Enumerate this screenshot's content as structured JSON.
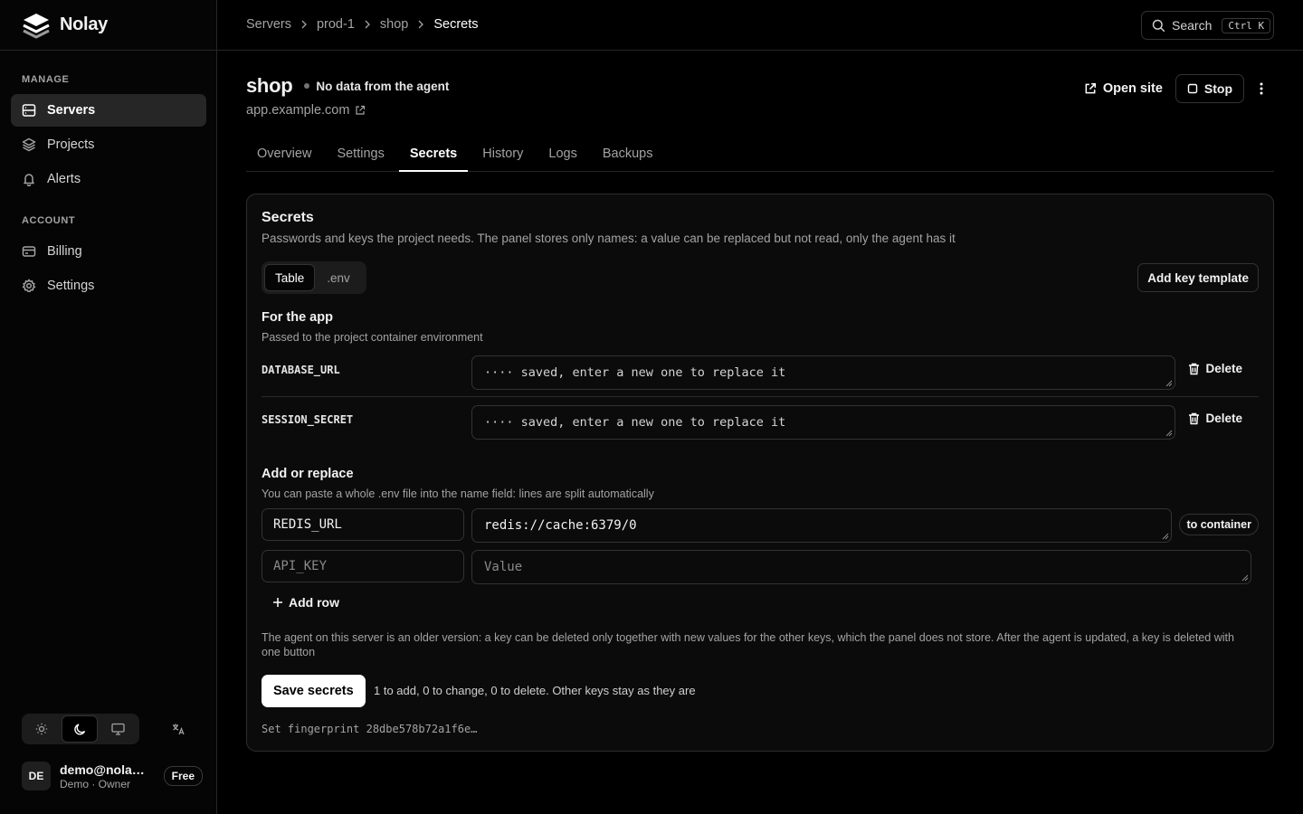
{
  "app": {
    "name": "Nolay"
  },
  "sidebar": {
    "sections": [
      {
        "label": "MANAGE",
        "items": [
          {
            "label": "Servers",
            "icon": "server-icon",
            "active": true
          },
          {
            "label": "Projects",
            "icon": "layers-icon"
          },
          {
            "label": "Alerts",
            "icon": "bell-icon"
          }
        ]
      },
      {
        "label": "ACCOUNT",
        "items": [
          {
            "label": "Billing",
            "icon": "credit-card-icon"
          },
          {
            "label": "Settings",
            "icon": "gear-icon"
          }
        ]
      }
    ],
    "theme_selected": "dark",
    "user": {
      "initials": "DE",
      "email": "demo@nolay...",
      "role": "Demo · Owner",
      "plan": "Free"
    }
  },
  "topbar": {
    "breadcrumbs": [
      "Servers",
      "prod-1",
      "shop",
      "Secrets"
    ],
    "search_label": "Search",
    "search_shortcut": "Ctrl K"
  },
  "project": {
    "name": "shop",
    "status": "No data from the agent",
    "domain": "app.example.com",
    "open_site_label": "Open site",
    "stop_label": "Stop"
  },
  "tabs": [
    "Overview",
    "Settings",
    "Secrets",
    "History",
    "Logs",
    "Backups"
  ],
  "active_tab": "Secrets",
  "secrets": {
    "title": "Secrets",
    "description": "Passwords and keys the project needs. The panel stores only names: a value can be replaced but not read, only the agent has it",
    "view_modes": [
      "Table",
      ".env"
    ],
    "active_view": "Table",
    "add_template_label": "Add key template",
    "app_section": {
      "title": "For the app",
      "description": "Passed to the project container environment",
      "rows": [
        {
          "key": "DATABASE_URL",
          "value_placeholder": "···· saved, enter a new one to replace it",
          "delete_label": "Delete"
        },
        {
          "key": "SESSION_SECRET",
          "value_placeholder": "···· saved, enter a new one to replace it",
          "delete_label": "Delete"
        }
      ]
    },
    "add_section": {
      "title": "Add or replace",
      "description": "You can paste a whole .env file into the name field: lines are split automatically",
      "rows": [
        {
          "name": "REDIS_URL",
          "value": "redis://cache:6379/0",
          "target": "to container"
        },
        {
          "name_placeholder": "API_KEY",
          "value_placeholder": "Value"
        }
      ],
      "add_row_label": "Add row"
    },
    "note": "The agent on this server is an older version: a key can be deleted only together with new values for the other keys, which the panel does not store. After the agent is updated, a key is deleted with one button",
    "save_label": "Save secrets",
    "save_summary": "1 to add, 0 to change, 0 to delete. Other keys stay as they are",
    "fingerprint": "Set fingerprint 28dbe578b72a1f6e…"
  }
}
